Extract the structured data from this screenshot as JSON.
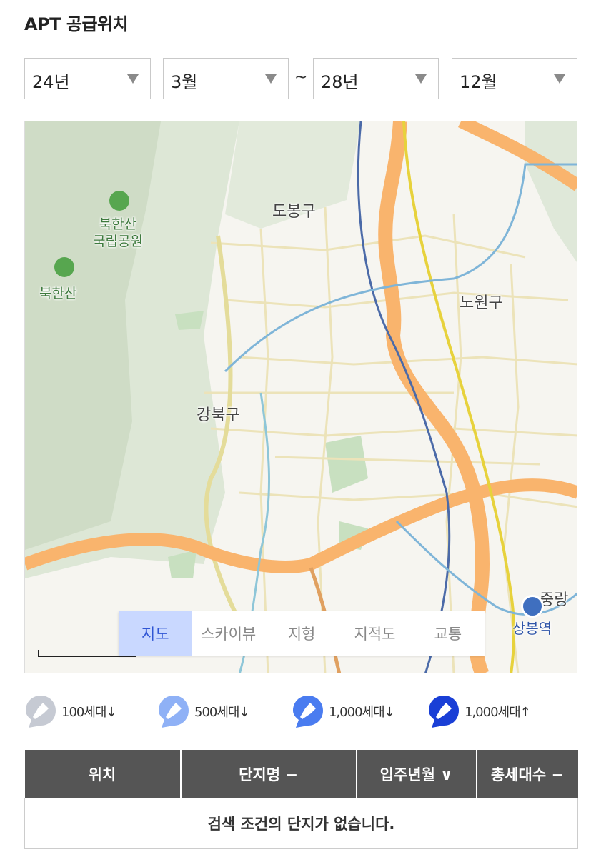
{
  "title": "APT 공급위치",
  "filters": {
    "start_year": "24년",
    "start_month": "3월",
    "separator": "~",
    "end_year": "28년",
    "end_month": "12월"
  },
  "map": {
    "labels": {
      "dobong": "도봉구",
      "nowon": "노원구",
      "gangbuk": "강북구",
      "park": "북한산\n국립공원",
      "mountain": "북한산",
      "station": "상봉역",
      "jungnang": "중랑"
    },
    "scale": "2km",
    "provider": "Kakao",
    "tabs": [
      "지도",
      "스카이뷰",
      "지형",
      "지적도",
      "교통"
    ],
    "active_tab": "지도"
  },
  "legend": [
    {
      "label": "100세대↓",
      "color": "#c6cad3"
    },
    {
      "label": "500세대↓",
      "color": "#8fb1f6"
    },
    {
      "label": "1,000세대↓",
      "color": "#4a7cf0"
    },
    {
      "label": "1,000세대↑",
      "color": "#1a3fd6"
    }
  ],
  "table": {
    "headers": [
      "위치",
      "단지명 −",
      "입주년월 ∨",
      "총세대수 −"
    ],
    "empty_message": "검색 조건의 단지가 없습니다."
  }
}
